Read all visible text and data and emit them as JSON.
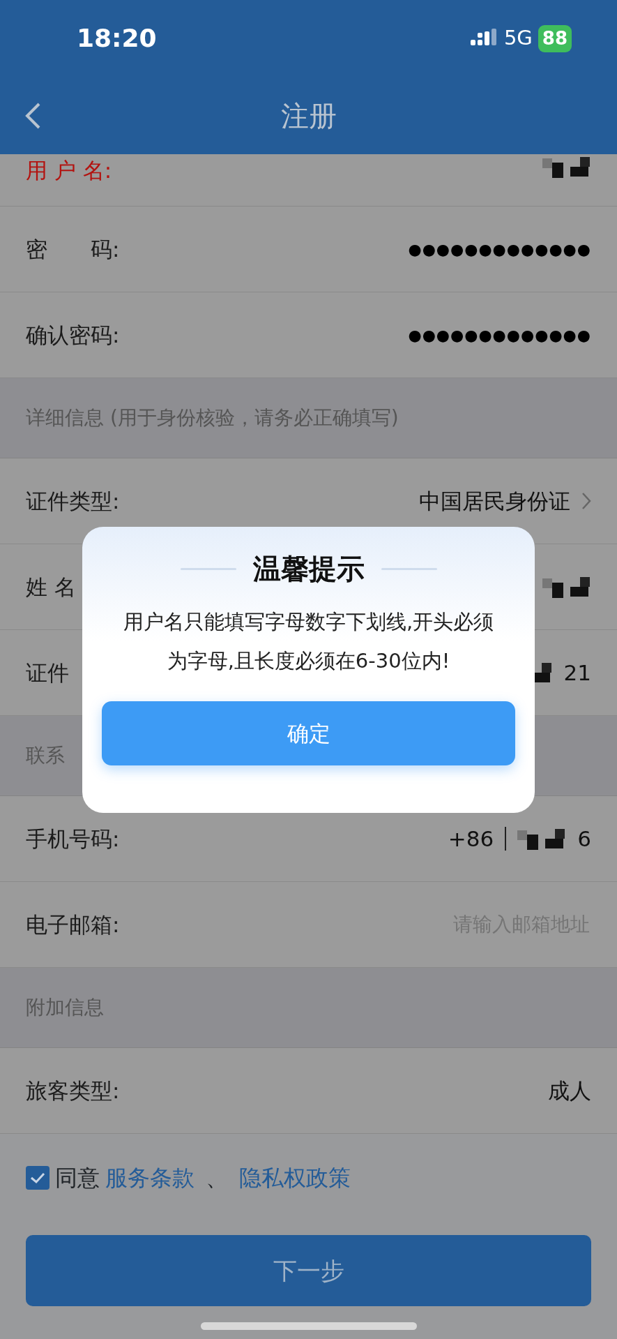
{
  "status_bar": {
    "time": "18:20",
    "network": "5G",
    "battery": "88"
  },
  "header": {
    "title": "注册"
  },
  "rows": [
    {
      "kind": "field",
      "label": "用 户 名:",
      "error": true,
      "masked": true
    },
    {
      "kind": "field",
      "label": "密　　码:",
      "value": "●●●●●●●●●●●●●",
      "error": false,
      "masked": false
    },
    {
      "kind": "field",
      "label": "确认密码:",
      "value": "●●●●●●●●●●●●●",
      "error": false,
      "masked": false
    },
    {
      "kind": "section",
      "label": "详细信息 (用于身份核验，请务必正确填写)"
    },
    {
      "kind": "select",
      "label": "证件类型:",
      "value": "中国居民身份证"
    },
    {
      "kind": "field",
      "label": "姓 名",
      "error": false,
      "masked": true
    },
    {
      "kind": "field",
      "label": "证件",
      "value": "21",
      "error": false,
      "masked": true
    },
    {
      "kind": "section",
      "label": "联系"
    },
    {
      "kind": "phone",
      "label": "手机号码:",
      "prefix": "+86",
      "value": "6",
      "masked": true
    },
    {
      "kind": "field",
      "label": "电子邮箱:",
      "placeholder": "请输入邮箱地址",
      "error": false,
      "masked": false
    },
    {
      "kind": "section",
      "label": "附加信息"
    },
    {
      "kind": "field",
      "label": "旅客类型:",
      "value": "成人",
      "error": false,
      "masked": false
    }
  ],
  "agreement": {
    "checked": true,
    "text": "同意",
    "links": [
      "服务条款",
      "隐私权政策"
    ],
    "separator": "、"
  },
  "next_button": "下一步",
  "dialog": {
    "title": "温馨提示",
    "message": "用户名只能填写字母数字下划线,开头必须为字母,且长度必须在6-30位内!",
    "button": "确定"
  }
}
